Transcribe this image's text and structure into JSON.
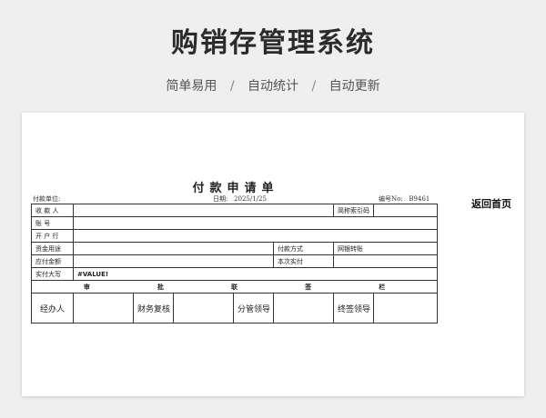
{
  "header": {
    "title": "购销存管理系统",
    "features": [
      "简单易用",
      "自动统计",
      "自动更新"
    ],
    "separator": "/"
  },
  "form": {
    "title": "付款申请单",
    "payer_label": "付款单位:",
    "date_label": "日期:",
    "date_value": "2025/1/25",
    "number_label": "编号No:",
    "number_value": "B9461",
    "back_link": "返回首页",
    "rows": {
      "payee": "收 款 人",
      "short_index": "简称索引码",
      "account": "账      号",
      "bank": "开 户 行",
      "purpose": "资金用途",
      "pay_method_label": "付款方式",
      "pay_method_value": "网银转账",
      "payable": "应付金额",
      "this_time": "本次实付",
      "amount_words": "实付大写",
      "amount_words_value": "#VALUE!"
    },
    "approval": {
      "header_chars": [
        "审",
        "批",
        "联",
        "签",
        "栏"
      ],
      "handler": "经办人",
      "finance_review": "财务复核",
      "supervisor": "分管领导",
      "final_sign": "终签领导"
    }
  }
}
